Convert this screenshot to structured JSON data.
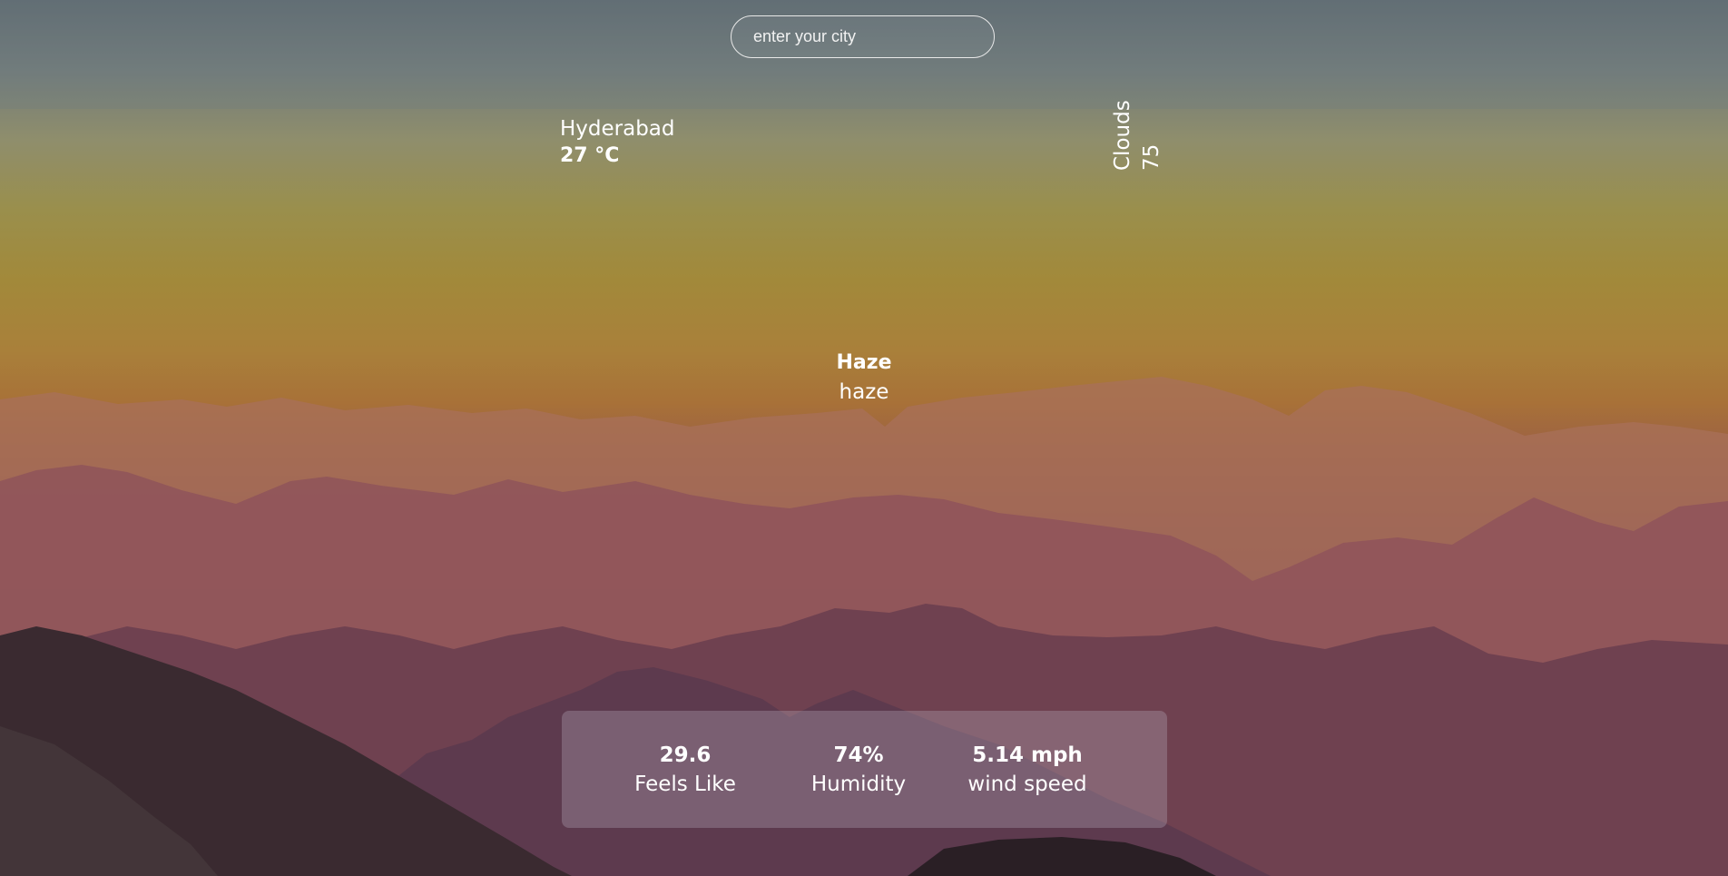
{
  "search": {
    "placeholder": "enter your city"
  },
  "location": {
    "city": "Hyderabad",
    "temperature": "27 °C"
  },
  "clouds": {
    "label": "Clouds",
    "value": "75"
  },
  "condition": {
    "main": "Haze",
    "description": "haze"
  },
  "stats": [
    {
      "value": "29.6",
      "label": "Feels Like"
    },
    {
      "value": "74%",
      "label": "Humidity"
    },
    {
      "value": "5.14 mph",
      "label": "wind speed"
    }
  ],
  "colors": {
    "text": "#ffffff",
    "panel": "#b9afbe",
    "sky_top": "#5f6a70",
    "sky_horizon": "#a9803a",
    "mountain_far": "#9b6b5e",
    "mountain_near": "#3a2a30"
  }
}
